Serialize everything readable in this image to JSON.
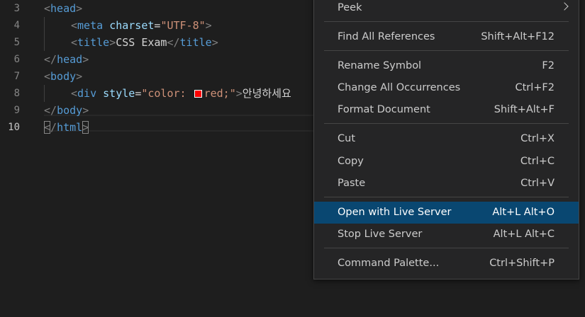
{
  "editor": {
    "line_numbers": [
      "3",
      "4",
      "5",
      "6",
      "7",
      "8",
      "9",
      "10"
    ],
    "lines": {
      "l3": {
        "lt": "<",
        "tag": "head",
        "gt": ">"
      },
      "l4": {
        "lt": "<",
        "tag": "meta",
        "attr": "charset",
        "eq": "=",
        "val": "\"UTF-8\"",
        "gt": ">"
      },
      "l5": {
        "lt": "<",
        "tag": "title",
        "gt": ">",
        "text": "CSS Exam",
        "lt2": "</",
        "tag2": "title",
        "gt2": ">"
      },
      "l6": {
        "lt": "</",
        "tag": "head",
        "gt": ">"
      },
      "l7": {
        "lt": "<",
        "tag": "body",
        "gt": ">"
      },
      "l8": {
        "lt": "<",
        "tag": "div",
        "attr": "style",
        "eq": "=",
        "val_a": "\"color: ",
        "val_b": "red;\"",
        "gt": ">",
        "text": "안녕하세요"
      },
      "l9": {
        "lt": "</",
        "tag": "body",
        "gt": ">"
      },
      "l10": {
        "lt": "<",
        "slash": "/",
        "tag": "html",
        "gt": ">"
      }
    },
    "swatch_color": "#ff0000"
  },
  "context_menu": {
    "peek": {
      "label": "Peek"
    },
    "find_all_references": {
      "label": "Find All References",
      "shortcut": "Shift+Alt+F12"
    },
    "rename_symbol": {
      "label": "Rename Symbol",
      "shortcut": "F2"
    },
    "change_all_occurrences": {
      "label": "Change All Occurrences",
      "shortcut": "Ctrl+F2"
    },
    "format_document": {
      "label": "Format Document",
      "shortcut": "Shift+Alt+F"
    },
    "cut": {
      "label": "Cut",
      "shortcut": "Ctrl+X"
    },
    "copy": {
      "label": "Copy",
      "shortcut": "Ctrl+C"
    },
    "paste": {
      "label": "Paste",
      "shortcut": "Ctrl+V"
    },
    "open_with_live_server": {
      "label": "Open with Live Server",
      "shortcut": "Alt+L Alt+O"
    },
    "stop_live_server": {
      "label": "Stop Live Server",
      "shortcut": "Alt+L Alt+C"
    },
    "command_palette": {
      "label": "Command Palette...",
      "shortcut": "Ctrl+Shift+P"
    }
  },
  "colors": {
    "background": "#1e1e1e",
    "menu_background": "#252526",
    "selected_item": "#094771",
    "tag": "#569cd6",
    "attribute": "#9cdcfe",
    "string": "#ce9178"
  }
}
